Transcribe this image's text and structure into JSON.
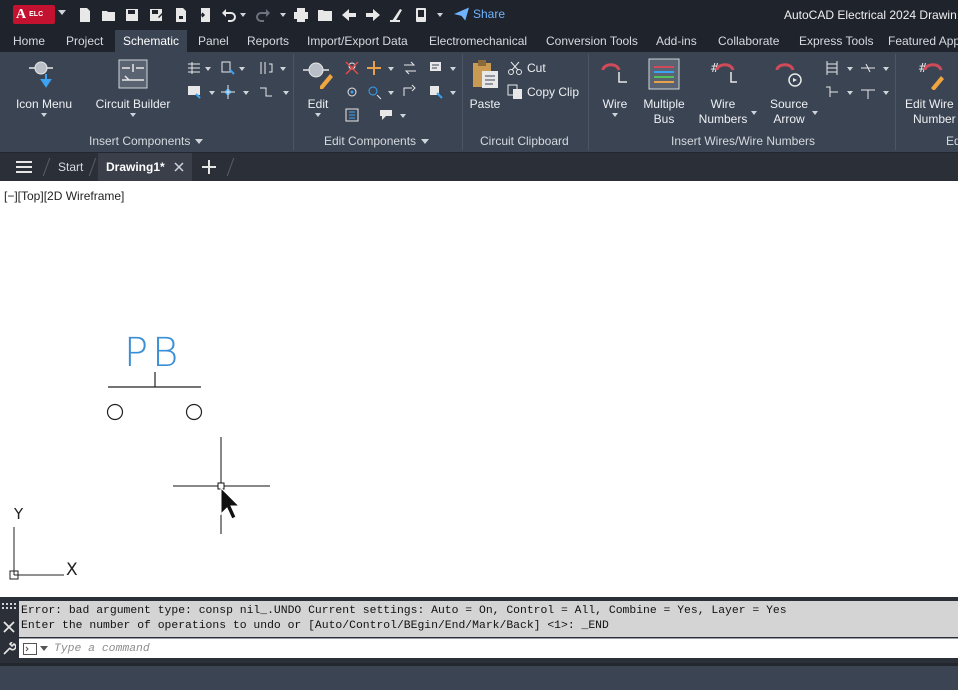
{
  "app": {
    "logo_letter": "A",
    "logo_suffix": "ELC",
    "title": "AutoCAD Electrical 2024  Drawin"
  },
  "quick_access": {
    "share_label": "Share",
    "icons": [
      "new-file-icon",
      "open-folder-icon",
      "save-icon",
      "save-as-icon",
      "save-to-cloud-icon",
      "import-icon",
      "undo-icon",
      "redo-icon",
      "plot-icon",
      "open-project-icon",
      "back-icon",
      "forward-icon",
      "sweep-icon",
      "device-icon",
      "workspace-dropdown-icon",
      "share-icon"
    ]
  },
  "ribbon_tabs": [
    {
      "label": "Home",
      "active": false
    },
    {
      "label": "Project",
      "active": false
    },
    {
      "label": "Schematic",
      "active": true
    },
    {
      "label": "Panel",
      "active": false
    },
    {
      "label": "Reports",
      "active": false
    },
    {
      "label": "Import/Export Data",
      "active": false
    },
    {
      "label": "Electromechanical",
      "active": false
    },
    {
      "label": "Conversion Tools",
      "active": false
    },
    {
      "label": "Add-ins",
      "active": false
    },
    {
      "label": "Collaborate",
      "active": false
    },
    {
      "label": "Express Tools",
      "active": false
    },
    {
      "label": "Featured App",
      "active": false
    }
  ],
  "ribbon": {
    "insert_components": {
      "label": "Insert Components",
      "icon_menu": "Icon Menu",
      "circuit_builder": "Circuit Builder"
    },
    "edit_components": {
      "label": "Edit Components",
      "edit": "Edit"
    },
    "circuit_clipboard": {
      "label": "Circuit Clipboard",
      "paste": "Paste",
      "cut": "Cut",
      "copy_clip": "Copy Clip"
    },
    "insert_wires": {
      "label": "Insert Wires/Wire Numbers",
      "wire": "Wire",
      "multiple_bus_1": "Multiple",
      "multiple_bus_2": "Bus",
      "wire_numbers_1": "Wire",
      "wire_numbers_2": "Numbers",
      "source_arrow_1": "Source",
      "source_arrow_2": "Arrow"
    },
    "edit_wire": {
      "label": "Ed",
      "edit_wire_1": "Edit Wire",
      "edit_wire_2": "Number"
    }
  },
  "document_tabs": {
    "start": "Start",
    "drawing": "Drawing1*"
  },
  "viewport": {
    "label": "[−][Top][2D Wireframe]"
  },
  "drawing": {
    "symbol_tag": "PB",
    "ucs_x": "X",
    "ucs_y": "Y",
    "symbol_color": "#3a8fd6"
  },
  "command_line": {
    "history_line_1": "Error: bad argument type: consp nil_.UNDO Current settings: Auto = On, Control = All, Combine = Yes, Layer = Yes",
    "history_line_2": "Enter the number of operations to undo or [Auto/Control/BEgin/End/Mark/Back] <1>: _END",
    "placeholder": "Type a command"
  },
  "colors": {
    "accent_share": "#6fb3ff",
    "logo_red": "#c3122f",
    "ribbon_bg": "#3b4453"
  }
}
